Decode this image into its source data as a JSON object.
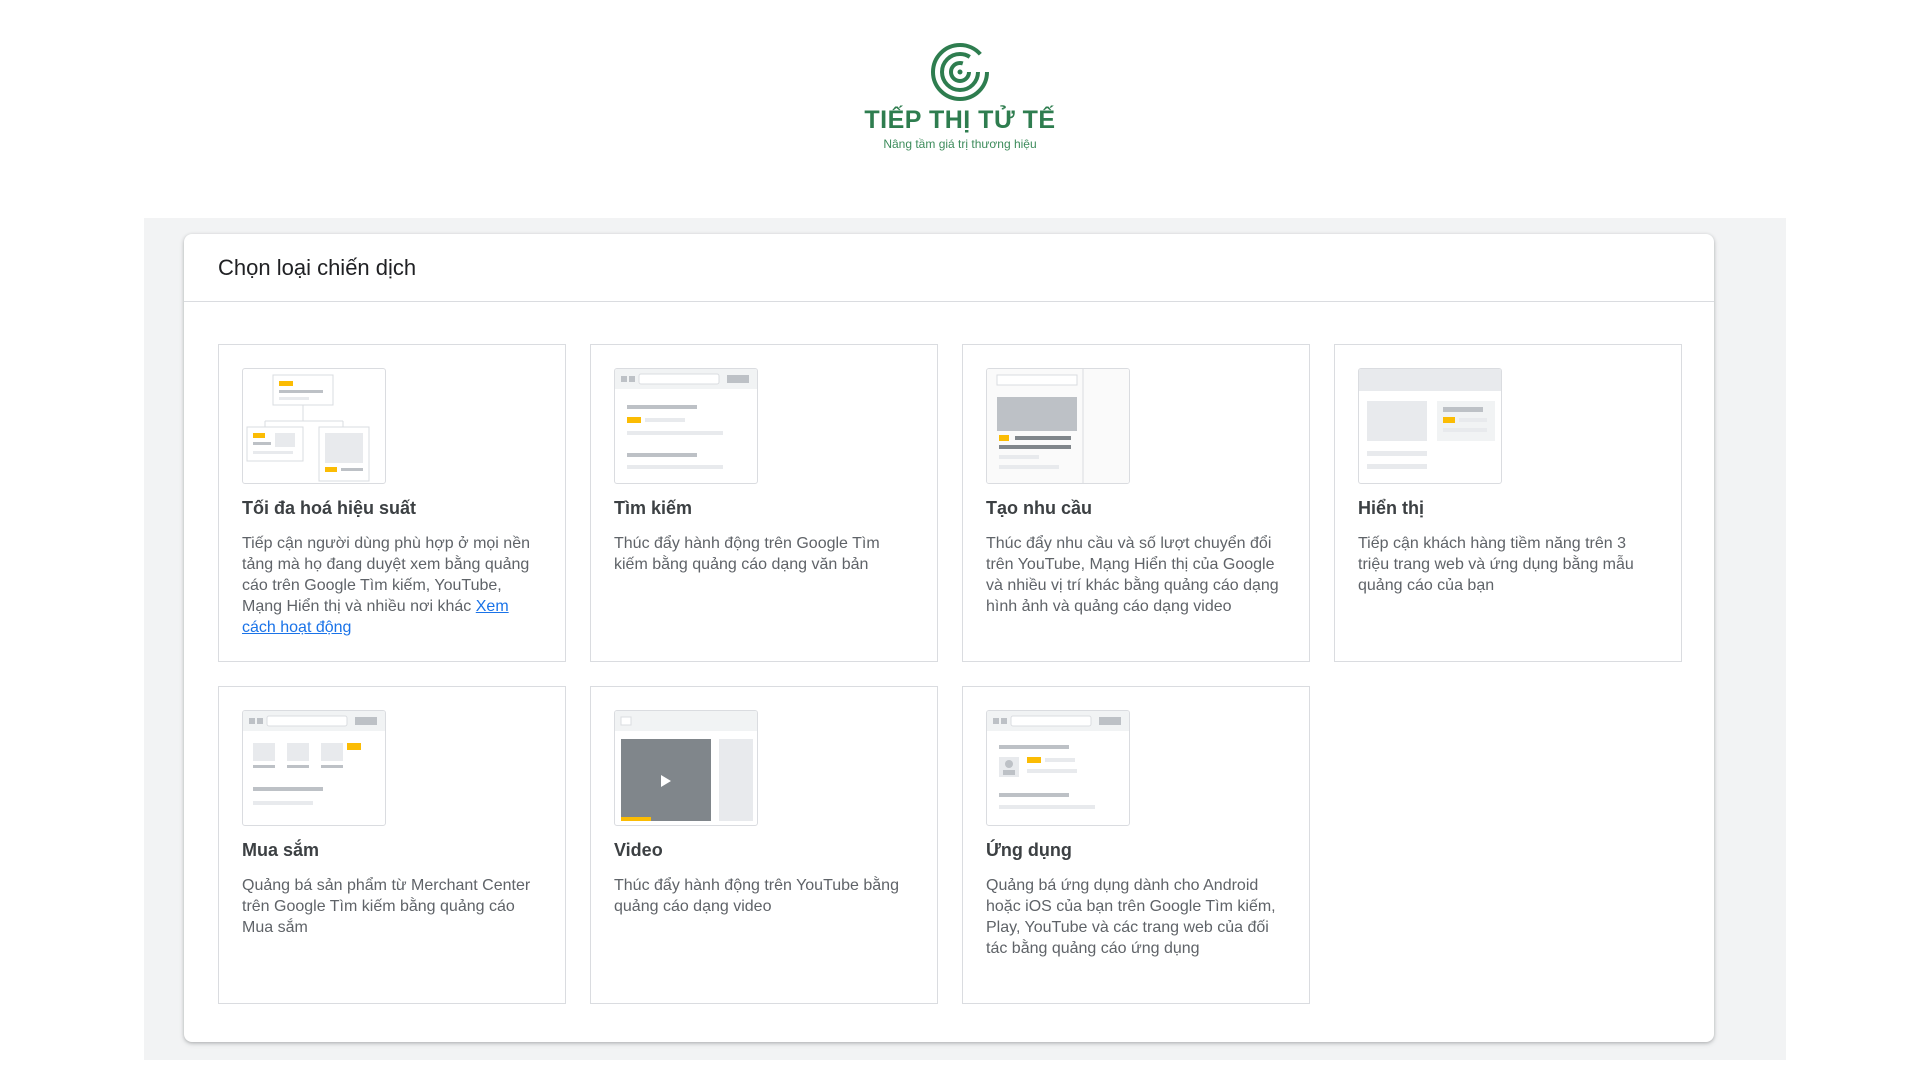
{
  "brand": {
    "logo_icon": "spiral-logo-icon",
    "name": "TIẾP THỊ TỬ TẾ",
    "slogan": "Nâng tầm giá trị thương hiệu",
    "color": "#2e7d4f"
  },
  "panel": {
    "title": "Chọn loại chiến dịch"
  },
  "colors": {
    "accent_yellow": "#fbbc04",
    "link_blue": "#1a73e8",
    "border": "#dadce0",
    "placeholder_grey": "#e8eaed"
  },
  "campaign_types": [
    {
      "icon": "performance-max-illustration",
      "title": "Tối đa hoá hiệu suất",
      "description": "Tiếp cận người dùng phù hợp ở mọi nền tảng mà họ đang duyệt xem bằng quảng cáo trên Google Tìm kiếm, YouTube, Mạng Hiển thị và nhiều nơi khác",
      "link": "Xem cách hoạt động"
    },
    {
      "icon": "search-campaign-illustration",
      "title": "Tìm kiếm",
      "description": "Thúc đẩy hành động trên Google Tìm kiếm bằng quảng cáo dạng văn bản"
    },
    {
      "icon": "demand-gen-illustration",
      "title": "Tạo nhu cầu",
      "description": "Thúc đẩy nhu cầu và số lượt chuyển đổi trên YouTube, Mạng Hiển thị của Google và nhiều vị trí khác bằng quảng cáo dạng hình ảnh và quảng cáo dạng video"
    },
    {
      "icon": "display-campaign-illustration",
      "title": "Hiển thị",
      "description": "Tiếp cận khách hàng tiềm năng trên 3 triệu trang web và ứng dụng bằng mẫu quảng cáo của bạn"
    },
    {
      "icon": "shopping-campaign-illustration",
      "title": "Mua sắm",
      "description": "Quảng bá sản phẩm từ Merchant Center trên Google Tìm kiếm bằng quảng cáo Mua sắm"
    },
    {
      "icon": "video-campaign-illustration",
      "title": "Video",
      "description": "Thúc đẩy hành động trên YouTube bằng quảng cáo dạng video"
    },
    {
      "icon": "app-campaign-illustration",
      "title": "Ứng dụng",
      "description": "Quảng bá ứng dụng dành cho Android hoặc iOS của bạn trên Google Tìm kiếm, Play, YouTube và các trang web của đối tác bằng quảng cáo ứng dụng"
    }
  ]
}
